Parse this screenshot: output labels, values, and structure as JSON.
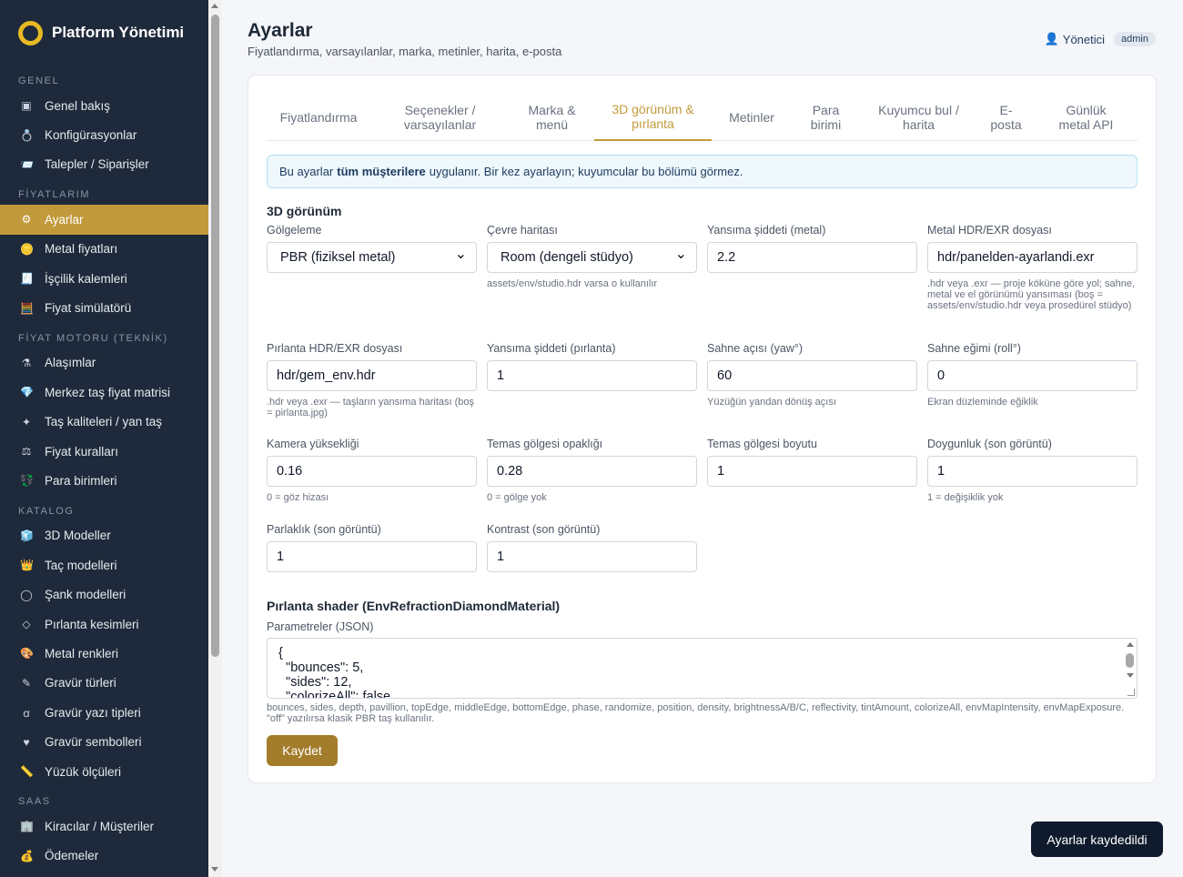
{
  "sidebar": {
    "brand": "Platform Yönetimi",
    "sections": [
      {
        "title": "GENEL",
        "items": [
          {
            "label": "Genel bakış",
            "icon": "dashboard-icon",
            "glyph": "▣"
          },
          {
            "label": "Konfigürasyonlar",
            "icon": "ring-icon",
            "glyph": "💍"
          },
          {
            "label": "Talepler / Siparişler",
            "icon": "inbox-icon",
            "glyph": "📨"
          }
        ]
      },
      {
        "title": "FİYATLARIM",
        "items": [
          {
            "label": "Ayarlar",
            "icon": "gear-icon",
            "glyph": "⚙",
            "active": true
          },
          {
            "label": "Metal fiyatları",
            "icon": "coin-icon",
            "glyph": "🪙"
          },
          {
            "label": "İşçilik kalemleri",
            "icon": "list-icon",
            "glyph": "🧾"
          },
          {
            "label": "Fiyat simülatörü",
            "icon": "abacus-icon",
            "glyph": "🧮"
          }
        ]
      },
      {
        "title": "FİYAT MOTORU (TEKNİK)",
        "items": [
          {
            "label": "Alaşımlar",
            "icon": "flask-icon",
            "glyph": "⚗"
          },
          {
            "label": "Merkez taş fiyat matrisi",
            "icon": "gem-icon",
            "glyph": "💎"
          },
          {
            "label": "Taş kaliteleri / yan taş",
            "icon": "sparkle-icon",
            "glyph": "✦"
          },
          {
            "label": "Fiyat kuralları",
            "icon": "scales-icon",
            "glyph": "⚖"
          },
          {
            "label": "Para birimleri",
            "icon": "currency-icon",
            "glyph": "💱"
          }
        ]
      },
      {
        "title": "KATALOG",
        "items": [
          {
            "label": "3D Modeller",
            "icon": "cube-icon",
            "glyph": "🧊"
          },
          {
            "label": "Taç modelleri",
            "icon": "crown-icon",
            "glyph": "👑"
          },
          {
            "label": "Şank modelleri",
            "icon": "circle-icon",
            "glyph": "◯"
          },
          {
            "label": "Pırlanta kesimleri",
            "icon": "diamond-outline-icon",
            "glyph": "◇"
          },
          {
            "label": "Metal renkleri",
            "icon": "palette-icon",
            "glyph": "🎨"
          },
          {
            "label": "Gravür türleri",
            "icon": "pen-icon",
            "glyph": "✎"
          },
          {
            "label": "Gravür yazı tipleri",
            "icon": "font-icon",
            "glyph": "ꭤ"
          },
          {
            "label": "Gravür sembolleri",
            "icon": "heart-icon",
            "glyph": "♥"
          },
          {
            "label": "Yüzük ölçüleri",
            "icon": "ruler-icon",
            "glyph": "📏"
          }
        ]
      },
      {
        "title": "SAAS",
        "items": [
          {
            "label": "Kiracılar / Müşteriler",
            "icon": "building-icon",
            "glyph": "🏢"
          },
          {
            "label": "Ödemeler",
            "icon": "money-bag-icon",
            "glyph": "💰"
          }
        ]
      }
    ]
  },
  "header": {
    "title": "Ayarlar",
    "subtitle": "Fiyatlandırma, varsayılanlar, marka, metinler, harita, e-posta",
    "user_name": "Yönetici",
    "user_role": "admin"
  },
  "tabs": [
    {
      "line1": "Fiyatlandırma",
      "line2": ""
    },
    {
      "line1": "Seçenekler /",
      "line2": "varsayılanlar"
    },
    {
      "line1": "Marka &",
      "line2": "menü"
    },
    {
      "line1": "3D görünüm &",
      "line2": "pırlanta",
      "active": true
    },
    {
      "line1": "Metinler",
      "line2": ""
    },
    {
      "line1": "Para",
      "line2": "birimi"
    },
    {
      "line1": "Kuyumcu bul /",
      "line2": "harita"
    },
    {
      "line1": "E-",
      "line2": "posta"
    },
    {
      "line1": "Günlük",
      "line2": "metal API"
    }
  ],
  "info": {
    "prefix": "Bu ayarlar",
    "bold": "tüm müşterilere",
    "suffix": "uygulanır. Bir kez ayarlayın; kuyumcular bu bölümü görmez."
  },
  "view3d": {
    "section_title": "3D görünüm",
    "fields": [
      {
        "label": "Gölgeleme",
        "value": "PBR (fiziksel metal)",
        "type": "select",
        "help": ""
      },
      {
        "label": "Çevre haritası",
        "value": "Room (dengeli stüdyo)",
        "type": "select",
        "help": "assets/env/studio.hdr varsa o kullanılır"
      },
      {
        "label": "Yansıma şiddeti (metal)",
        "value": "2.2",
        "type": "input",
        "help": ""
      },
      {
        "label": "Metal HDR/EXR dosyası",
        "value": "hdr/panelden-ayarlandi.exr",
        "type": "input",
        "help": ".hdr veya .exr — proje köküne göre yol; sahne, metal ve el görünümü yansıması (boş = assets/env/studio.hdr veya prosedürel stüdyo)"
      },
      {
        "label": "Pırlanta HDR/EXR dosyası",
        "value": "hdr/gem_env.hdr",
        "type": "input",
        "help": ".hdr veya .exr — taşların yansıma haritası (boş = pirlanta.jpg)"
      },
      {
        "label": "Yansıma şiddeti (pırlanta)",
        "value": "1",
        "type": "input",
        "help": ""
      },
      {
        "label": "Sahne açısı (yaw°)",
        "value": "60",
        "type": "input",
        "help": "Yüzüğün yandan dönüş açısı"
      },
      {
        "label": "Sahne eğimi (roll°)",
        "value": "0",
        "type": "input",
        "help": "Ekran düzleminde eğiklik"
      },
      {
        "label": "Kamera yüksekliği",
        "value": "0.16",
        "type": "input",
        "help": "0 = göz hizası"
      },
      {
        "label": "Temas gölgesi opaklığı",
        "value": "0.28",
        "type": "input",
        "help": "0 = gölge yok"
      },
      {
        "label": "Temas gölgesi boyutu",
        "value": "1",
        "type": "input",
        "help": ""
      },
      {
        "label": "Doygunluk (son görüntü)",
        "value": "1",
        "type": "input",
        "help": "1 = değişiklik yok"
      },
      {
        "label": "Parlaklık (son görüntü)",
        "value": "1",
        "type": "input",
        "help": ""
      },
      {
        "label": "Kontrast (son görüntü)",
        "value": "1",
        "type": "input",
        "help": ""
      }
    ]
  },
  "shader": {
    "section_title": "Pırlanta shader (EnvRefractionDiamondMaterial)",
    "params_label": "Parametreler (JSON)",
    "json_lines": [
      "{",
      "  \"bounces\": 5,",
      "  \"sides\": 12,",
      "  \"colorizeAll\": false"
    ],
    "help": "bounces, sides, depth, pavillion, topEdge, middleEdge, bottomEdge, phase, randomize, position, density, brightnessA/B/C, reflectivity, tintAmount, colorizeAll, envMapIntensity, envMapExposure. \"off\" yazılırsa klasik PBR taş kullanılır."
  },
  "save_label": "Kaydet",
  "toast": "Ayarlar kaydedildi",
  "colors": {
    "sidebar_bg": "#1e2a3b",
    "accent": "#c29a3b",
    "save_button": "#a37c2c",
    "toast_bg": "#0f1b2d"
  }
}
